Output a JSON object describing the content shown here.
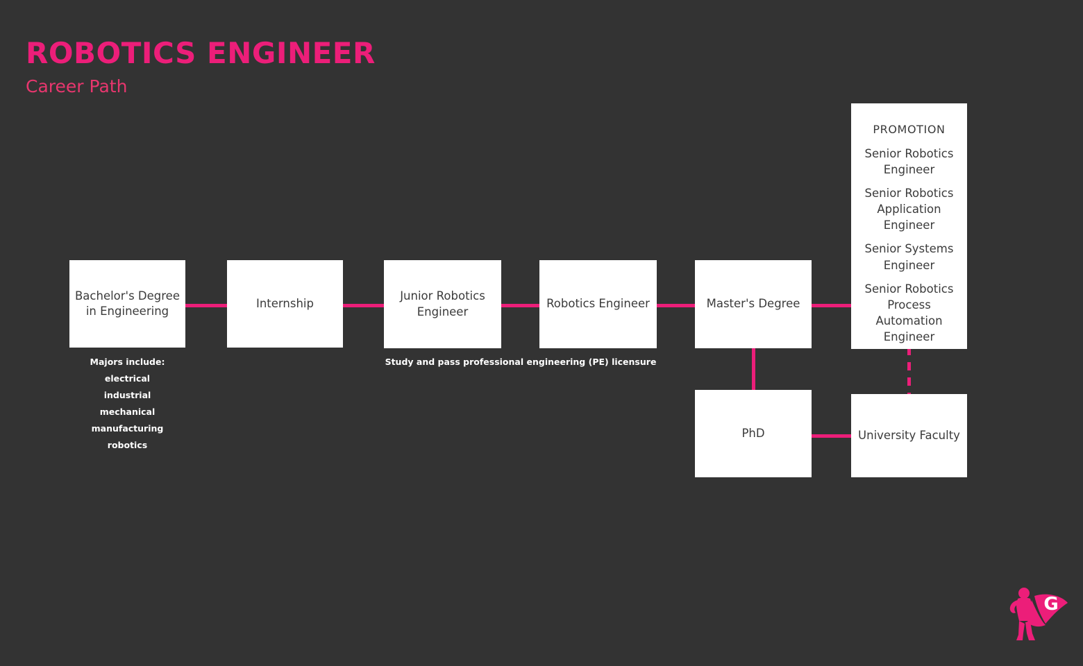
{
  "header": {
    "title": "ROBOTICS ENGINEER",
    "subtitle": "Career Path"
  },
  "colors": {
    "background": "#333333",
    "accent_pink": "#EC1E79",
    "node_fill": "#FFFFFF",
    "node_text": "#3b3b3b",
    "caption_text": "#FFFFFF"
  },
  "nodes": {
    "bachelors": {
      "line1": "Bachelor's  Degree",
      "line2": "in Engineering"
    },
    "internship": {
      "line1": "Internship"
    },
    "junior_robotics_engineer": {
      "line1": "Junior Robotics",
      "line2": "Engineer"
    },
    "robotics_engineer": {
      "line1": "Robotics Engineer"
    },
    "masters": {
      "line1": "Master's Degree"
    },
    "phd": {
      "line1": "PhD"
    },
    "university_faculty": {
      "line1": "University Faculty"
    }
  },
  "promotion": {
    "heading": "PROMOTION",
    "items": [
      "Senior Robotics Engineer",
      "Senior Robotics Application Engineer",
      "Senior Systems Engineer",
      "Senior Robotics Process Automation Engineer"
    ]
  },
  "captions": {
    "majors": {
      "heading": "Majors include:",
      "items": [
        "electrical",
        "industrial",
        "mechanical",
        "manufacturing",
        "robotics"
      ]
    },
    "licensure": "Study and pass professional engineering (PE) licensure"
  },
  "logo": {
    "name": "superhero-g-logo",
    "letter": "G"
  }
}
